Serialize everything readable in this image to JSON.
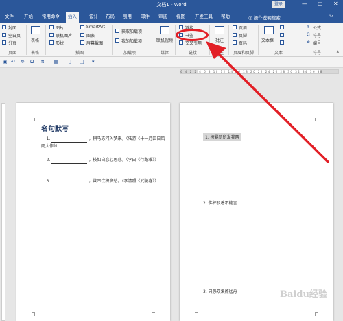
{
  "titlebar": {
    "title": "文档1 - Word",
    "login": "登录",
    "min": "—",
    "max": "□",
    "close": "✕"
  },
  "tabs": [
    "文件",
    "开始",
    "常用命令",
    "插入",
    "设计",
    "布局",
    "引用",
    "邮件",
    "审阅",
    "视图",
    "开发工具",
    "帮助"
  ],
  "tell_me": "操作说明搜索",
  "share": "⚇",
  "ribbon": {
    "pages": {
      "cover": "封面",
      "blank": "空白页",
      "break": "分页",
      "group": "页面"
    },
    "table": {
      "label": "表格",
      "group": "表格"
    },
    "illustrations": {
      "picture": "图片",
      "online_picture": "联机图片",
      "shapes": "形状",
      "smartart": "SmartArt",
      "chart": "图表",
      "screenshot": "屏幕截图",
      "group": "插图"
    },
    "addins": {
      "get": "获取加载项",
      "my": "我的加载项",
      "group": "加载项"
    },
    "media": {
      "video": "联机视频",
      "group": "媒体"
    },
    "links": {
      "link": "链接",
      "bookmark": "书签",
      "cross_ref": "交叉引用",
      "group": "链接"
    },
    "comments": {
      "comment": "批注",
      "group": "批注"
    },
    "header_footer": {
      "header": "页眉",
      "footer": "页脚",
      "page_number": "页码",
      "group": "页眉和页脚"
    },
    "text": {
      "textbox": "文本框",
      "group": "文本"
    },
    "symbols": {
      "equation": "公式",
      "symbol": "符号",
      "number": "编号",
      "group": "符号"
    }
  },
  "qat_icons": [
    "save-icon",
    "undo-icon",
    "redo-icon",
    "omega-icon",
    "pi-icon",
    "table-icon",
    "page-icon",
    "shape-icon",
    "more-icon"
  ],
  "ruler_ticks": "6 4 2  2 4 6 8 10 12 14 16 18 20 22 24 26 28 30 32 34 36 38",
  "page1": {
    "title": "名句默写",
    "questions": [
      {
        "num": "1.",
        "text": "，耕马冻河入梦来。（陆游《十一月四日风雨大作》）"
      },
      {
        "num": "2.",
        "text": "，枝如自恋心思悲。（李白《行路难》）"
      },
      {
        "num": "3.",
        "text": "，欲不饮将多愁。（李清照《武陵春》）"
      }
    ]
  },
  "page2": {
    "items": [
      {
        "num": "1.",
        "text": "按暴新所发我两"
      },
      {
        "num": "2.",
        "text": "佛杯驳着不能言"
      },
      {
        "num": "3.",
        "text": "只恐双溪舴艋舟"
      }
    ]
  },
  "watermark": "Baidu经验",
  "colors": {
    "word_blue": "#2b579a",
    "annotation_red": "#e21f26"
  }
}
